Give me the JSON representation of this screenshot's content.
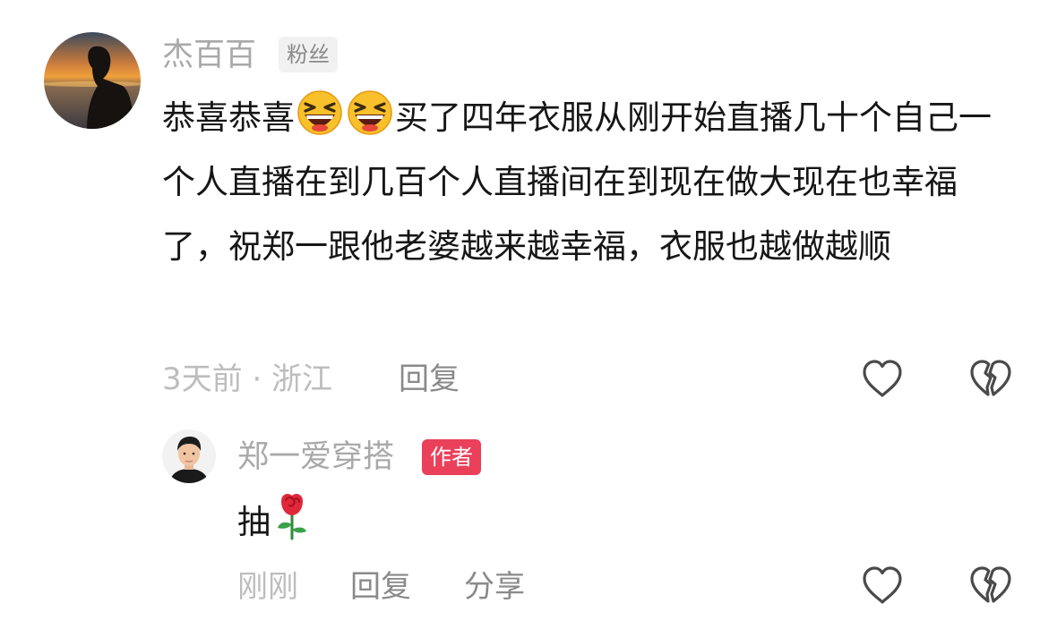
{
  "comment": {
    "username": "杰百百",
    "tag": "粉丝",
    "text_before_emoji": "恭喜恭喜",
    "emojis": [
      "laughing-emoji",
      "laughing-emoji"
    ],
    "text_after_emoji": "买了四年衣服从刚开始直播几十个自己一个人直播在到几百个人直播间在到现在做大现在也幸福了，祝郑一跟他老婆越来越幸福，衣服也越做越顺",
    "time_location": "3天前 · 浙江",
    "reply_label": "回复"
  },
  "reply": {
    "username": "郑一爱穿搭",
    "tag": "作者",
    "text": "抽",
    "emoji": "rose-emoji",
    "time": "刚刚",
    "reply_label": "回复",
    "share_label": "分享"
  },
  "icons": {
    "like": "heart-outline-icon",
    "dislike": "broken-heart-outline-icon"
  },
  "colors": {
    "author_tag_bg": "#ea4059",
    "fan_tag_bg": "#f1f1f1",
    "username": "#a9a9a9",
    "content": "#161616",
    "meta": "#bdbdbd",
    "action": "#8a8a8a"
  }
}
